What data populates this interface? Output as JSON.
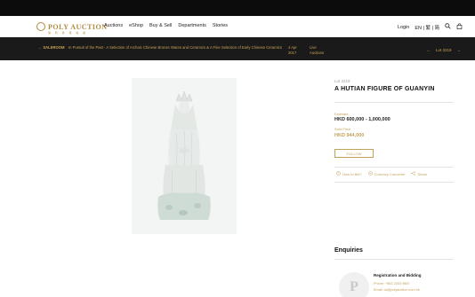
{
  "header": {
    "logo_text": "POLY AUCTION",
    "logo_sub": "保 利 香 港 拍 賣",
    "nav": [
      "Auctions",
      "eShop",
      "Buy & Sell",
      "Departments",
      "Stories"
    ],
    "login": "Login",
    "lang": "EN | 繁 | 简",
    "icons": [
      "search-icon",
      "bag-icon"
    ]
  },
  "salebar": {
    "saleroom": "← SALEROOM",
    "title": "In Pursuit of the Past - A Selection of Archaic Chinese Bronze Wares and Ceramics & A Fine Selection of Early Chinese Ceramics",
    "date": "4 Apr 2017",
    "live": "Live Auctions",
    "prev": "←",
    "lot": "Lot 3219",
    "next": "→"
  },
  "lot": {
    "number": "Lot 3219",
    "title": "A HUTIAN FIGURE OF GUANYIN",
    "estimate_label": "Estimate",
    "estimate_value": "HKD 600,000 - 1,000,000",
    "sold_label": "Sold Price",
    "sold_value": "HKD 944,000",
    "follow_label": "FOLLOW",
    "actions": [
      "How to Bid?",
      "Currency Converter",
      "Share"
    ]
  },
  "enquiries": {
    "title": "Enquiries",
    "head": "Registration and Bidding",
    "phone": "Phone: +852 2303 9887",
    "email": "Email: cs@polyauction.com.hk"
  },
  "colors": {
    "gold": "#c4a15a",
    "dark": "#1a1a1a"
  }
}
